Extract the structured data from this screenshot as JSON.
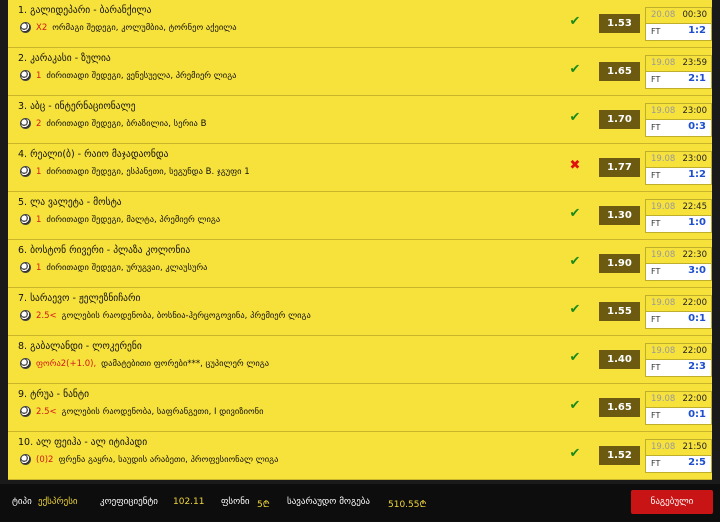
{
  "colors": {
    "row_bg": "#f7e23c",
    "odd_bg": "#6b5a10",
    "win": "#1a8a1a",
    "loss": "#e01010",
    "score": "#1d4fd0",
    "button": "#c81414"
  },
  "bets": [
    {
      "title": "1. გალიდეპარი - ბარანქილა",
      "pick": "X2",
      "desc": "ორმაგი შედეგი, კოლუმბია, ტორნეო აქეილა",
      "status": "✔",
      "win": true,
      "odd": "1.53",
      "date": "20.08",
      "time": "00:30",
      "ft": "FT",
      "score": "1:2"
    },
    {
      "title": "2. კარაკასი - ზულია",
      "pick": "1",
      "desc": "ძირითადი შედეგი, ვენესუელა, პრემიერ ლიგა",
      "status": "✔",
      "win": true,
      "odd": "1.65",
      "date": "19.08",
      "time": "23:59",
      "ft": "FT",
      "score": "2:1"
    },
    {
      "title": "3. აბც - ინტერნაციონალე",
      "pick": "2",
      "desc": "ძირითადი შედეგი, ბრაზილია, სერია B",
      "status": "✔",
      "win": true,
      "odd": "1.70",
      "date": "19.08",
      "time": "23:00",
      "ft": "FT",
      "score": "0:3"
    },
    {
      "title": "4. რეალი(ბ) - რაიო მაჯადაონდა",
      "pick": "1",
      "desc": "ძირითადი შედეგი, ესპანეთი, სეგუნდა B. ჯგუფი 1",
      "status": "✖",
      "win": false,
      "odd": "1.77",
      "date": "19.08",
      "time": "23:00",
      "ft": "FT",
      "score": "1:2"
    },
    {
      "title": "5. ლა ვალეტა - მოსტა",
      "pick": "1",
      "desc": "ძირითადი შედეგი, მალტა, პრემიერ ლიგა",
      "status": "✔",
      "win": true,
      "odd": "1.30",
      "date": "19.08",
      "time": "22:45",
      "ft": "FT",
      "score": "1:0"
    },
    {
      "title": "6. ბოსტონ რივერი - პლაზა კოლონია",
      "pick": "1",
      "desc": "ძირითადი შედეგი, ურუგვაი, კლაუსურა",
      "status": "✔",
      "win": true,
      "odd": "1.90",
      "date": "19.08",
      "time": "22:30",
      "ft": "FT",
      "score": "3:0"
    },
    {
      "title": "7. სარაევო - ჟელეზნიჩარი",
      "pick": "2.5<",
      "desc": "გოლების რაოდენობა, ბოსნია-ჰერცოგოვინა, პრემიერ ლიგა",
      "status": "✔",
      "win": true,
      "odd": "1.55",
      "date": "19.08",
      "time": "22:00",
      "ft": "FT",
      "score": "0:1"
    },
    {
      "title": "8. გაბალანდი - ლოკერენი",
      "pick": "ფორა2(+1.0),",
      "desc": "დამატებითი ფორები***, ცუპილერ ლიგა",
      "status": "✔",
      "win": true,
      "odd": "1.40",
      "date": "19.08",
      "time": "22:00",
      "ft": "FT",
      "score": "2:3"
    },
    {
      "title": "9. ტრუა - ნანტი",
      "pick": "2.5<",
      "desc": "გოლების რაოდენობა, საფრანგეთი, I დივიზიონი",
      "status": "✔",
      "win": true,
      "odd": "1.65",
      "date": "19.08",
      "time": "22:00",
      "ft": "FT",
      "score": "0:1"
    },
    {
      "title": "10. ალ ფეიჰა - ალ იტიჰადი",
      "pick": "(0)2",
      "desc": "ფრენა გაყრა, საუდის არაბეთი, პროფესიონალ ლიგა",
      "status": "✔",
      "win": true,
      "odd": "1.52",
      "date": "19.08",
      "time": "21:50",
      "ft": "FT",
      "score": "2:5"
    }
  ],
  "footer": {
    "type_label": "ტიპი",
    "type_value": "ექსპრესი",
    "coef_label": "კოეფიციენტი",
    "coef_value": "102.11",
    "stake_label": "ფსონი",
    "stake_value": "5₾",
    "win_label": "სავარაუდო მოგება",
    "win_value": "510.55₾",
    "button": "ნაგებული"
  }
}
